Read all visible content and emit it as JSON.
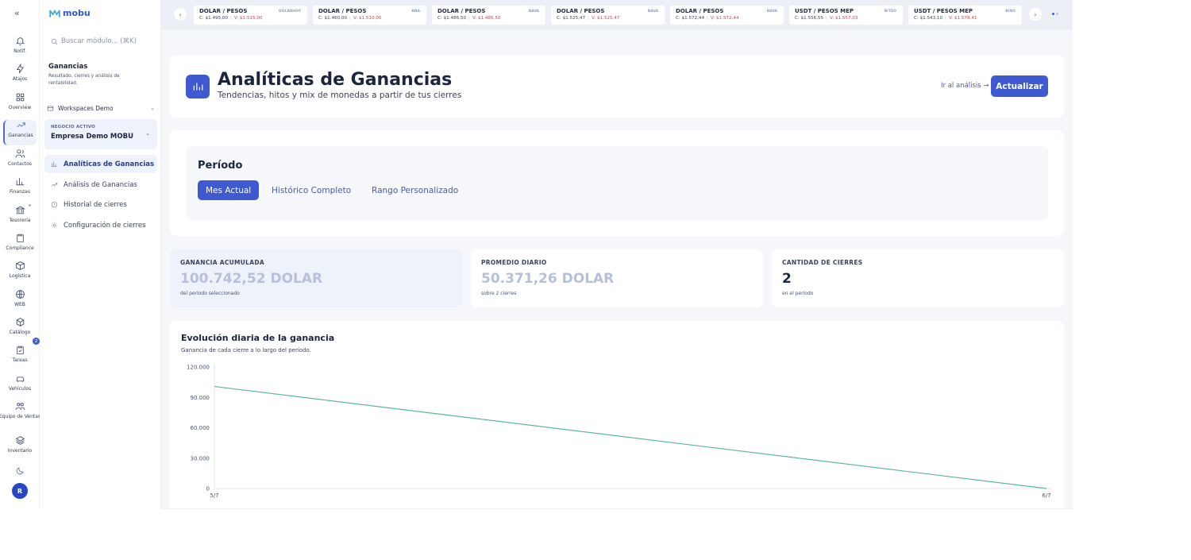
{
  "rail": {
    "items": [
      {
        "label": "Notif.",
        "icon": "bell-icon"
      },
      {
        "label": "Atajos",
        "icon": "bolt-icon"
      },
      {
        "label": "Overview",
        "icon": "grid-icon"
      },
      {
        "label": "Ganancias",
        "icon": "trend-icon"
      },
      {
        "label": "Contactos",
        "icon": "users-icon"
      },
      {
        "label": "Finanzas",
        "icon": "bar-chart-icon"
      },
      {
        "label": "Tesorería",
        "icon": "bank-icon"
      },
      {
        "label": "Compliance",
        "icon": "clipboard-icon"
      },
      {
        "label": "Logística",
        "icon": "box-icon"
      },
      {
        "label": "WEB",
        "icon": "globe-icon"
      },
      {
        "label": "Catálogo",
        "icon": "package-icon"
      },
      {
        "label": "Tareas",
        "icon": "task-icon"
      },
      {
        "label": "Vehículos",
        "icon": "car-icon"
      },
      {
        "label": "Equipo de Ventas",
        "icon": "team-icon"
      },
      {
        "label": "Inventario",
        "icon": "layers-icon"
      }
    ],
    "catalog_badge": "2",
    "avatar_initial": "R"
  },
  "side": {
    "brand": "mobu",
    "search_placeholder": "Buscar módulo... (⌘K)",
    "section_title": "Ganancias",
    "section_desc": "Resultado, cierres y análisis de rentabilidad.",
    "workspace": "Workspaces Demo",
    "business_kicker": "NEGOCIO ACTIVO",
    "business_name": "Empresa Demo MOBU",
    "nav": [
      {
        "label": "Analíticas de Ganancias",
        "icon": "bar-chart-icon"
      },
      {
        "label": "Análisis de Ganancias",
        "icon": "trend-icon"
      },
      {
        "label": "Historial de cierres",
        "icon": "clock-icon"
      },
      {
        "label": "Configuración de cierres",
        "icon": "gear-icon"
      }
    ]
  },
  "ticker": [
    {
      "name": "DOLAR / PESOS",
      "source": "DOLARHOY",
      "c": "C: $1.495,00",
      "v": "V: $1.515,00"
    },
    {
      "name": "DOLAR / PESOS",
      "source": "BNA",
      "c": "C: $1.460,00",
      "v": "V: $1.510,00"
    },
    {
      "name": "DOLAR / PESOS",
      "source": "BAVA",
      "c": "C: $1.486,50",
      "v": "V: $1.486,50"
    },
    {
      "name": "DOLAR / PESOS",
      "source": "BAVA",
      "c": "C: $1.525,47",
      "v": "V: $1.525,47"
    },
    {
      "name": "DOLAR / PESOS",
      "source": "BAVA",
      "c": "C: $1.572,44",
      "v": "V: $1.572,44"
    },
    {
      "name": "USDT / PESOS MEP",
      "source": "BITSO",
      "c": "C: $1.556,55",
      "v": "V: $1.557,03"
    },
    {
      "name": "USDT / PESOS MEP",
      "source": "BINO",
      "c": "C: $1.543,10",
      "v": "V: $1.578,41"
    }
  ],
  "header": {
    "title": "Analíticas de Ganancias",
    "subtitle": "Tendencias, hitos y mix de monedas a partir de tus cierres",
    "link": "Ir al análisis →",
    "button": "Actualizar"
  },
  "period": {
    "title": "Período",
    "options": [
      "Mes Actual",
      "Histórico Completo",
      "Rango Personalizado"
    ],
    "selected": "Mes Actual"
  },
  "kpis": [
    {
      "label": "GANANCIA ACUMULADA",
      "value": "100.742,52 DOLAR",
      "sub": "del período seleccionado"
    },
    {
      "label": "PROMEDIO DIARIO",
      "value": "50.371,26 DOLAR",
      "sub": "sobre 2 cierres"
    },
    {
      "label": "CANTIDAD DE CIERRES",
      "value": "2",
      "sub": "en el período"
    }
  ],
  "colors": {
    "accent": "#3f5ad0",
    "line": "#5fb4a8",
    "sell": "#c8454f"
  },
  "chart_data": {
    "type": "line",
    "title": "Evolución diaria de la ganancia",
    "subtitle": "Ganancia de cada cierre a lo largo del período.",
    "x": [
      "5/7",
      "6/7"
    ],
    "series": [
      {
        "values": [
          100742.52,
          0
        ]
      }
    ],
    "ylim": [
      0,
      120000
    ],
    "yticks": [
      "120.000",
      "90.000",
      "60.000",
      "30.000",
      "0"
    ],
    "grid": false
  }
}
